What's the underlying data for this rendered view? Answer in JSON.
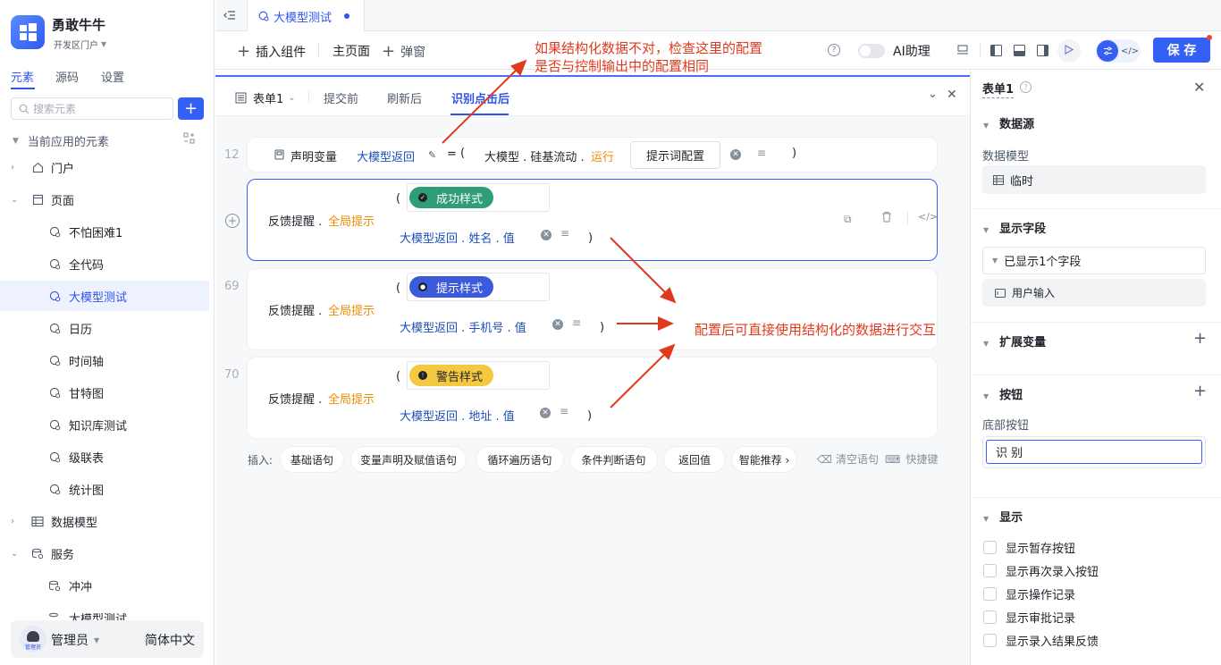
{
  "app": {
    "name": "勇敢牛牛",
    "portal": "开发区门户"
  },
  "sidebar": {
    "tabs": [
      "元素",
      "源码",
      "设置"
    ],
    "search_placeholder": "搜索元素",
    "section_title": "当前应用的元素",
    "items": [
      {
        "label": "门户",
        "icon": "home-icon"
      },
      {
        "label": "页面",
        "icon": "page-icon"
      },
      {
        "label": "不怕困难1",
        "icon": "page-item-icon"
      },
      {
        "label": "全代码",
        "icon": "page-item-icon"
      },
      {
        "label": "大模型测试",
        "icon": "page-item-icon"
      },
      {
        "label": "日历",
        "icon": "page-item-icon"
      },
      {
        "label": "时间轴",
        "icon": "page-item-icon"
      },
      {
        "label": "甘特图",
        "icon": "page-item-icon"
      },
      {
        "label": "知识库测试",
        "icon": "page-item-icon"
      },
      {
        "label": "级联表",
        "icon": "page-item-icon"
      },
      {
        "label": "统计图",
        "icon": "page-item-icon"
      },
      {
        "label": "数据模型",
        "icon": "table-icon"
      },
      {
        "label": "服务",
        "icon": "service-icon"
      },
      {
        "label": "冲冲",
        "icon": "service-item-icon"
      },
      {
        "label": "大模型测试",
        "icon": "service-item-icon"
      }
    ],
    "footer": {
      "user": "管理员",
      "avatar_text": "管理员",
      "language": "简体中文"
    }
  },
  "tabbar": {
    "tab_label": "大模型测试"
  },
  "toolbar": {
    "insert_component": "插入组件",
    "main_page": "主页面",
    "popup": "弹窗",
    "ai_assistant": "AI助理",
    "save": "保 存"
  },
  "editor": {
    "tabs": [
      "表单1",
      "提交前",
      "刷新后",
      "识别点击后"
    ],
    "line_numbers": [
      "12",
      "69",
      "70"
    ],
    "declare": {
      "keyword": "声明变量",
      "var_name": "大模型返回",
      "eq": "=",
      "open": "(",
      "source": "大模型 . 硅基流动 .",
      "run": "运行",
      "prompt_btn": "提示词配置",
      "close": ")"
    },
    "feedback_rows": [
      {
        "prefix": "反馈提醒 .",
        "mode": "全局提示",
        "style": "成功样式",
        "field": "大模型返回 . 姓名 . 值",
        "color": "#2e9d78"
      },
      {
        "prefix": "反馈提醒 .",
        "mode": "全局提示",
        "style": "提示样式",
        "field": "大模型返回 . 手机号 . 值",
        "color": "#3b5bdb"
      },
      {
        "prefix": "反馈提醒 .",
        "mode": "全局提示",
        "style": "警告样式",
        "field": "大模型返回 . 地址 . 值",
        "color": "#f5c842"
      }
    ],
    "open_paren": "(",
    "close_paren": ")",
    "insert_label": "插入:",
    "insert_chips": [
      "基础语句",
      "变量声明及赋值语句",
      "循环遍历语句",
      "条件判断语句",
      "返回值",
      "智能推荐 ›"
    ],
    "clear": "清空语句",
    "shortcut": "快捷键"
  },
  "annotations": {
    "top_line1": "如果结构化数据不对，检查这里的配置",
    "top_line2": "是否与控制输出中的配置相同",
    "right": "配置后可直接使用结构化的数据进行交互"
  },
  "right_panel": {
    "title": "表单1",
    "datasource": {
      "title": "数据源",
      "model_label": "数据模型",
      "model_value": "临时"
    },
    "fields": {
      "title": "显示字段",
      "summary": "已显示1个字段",
      "item": "用户输入"
    },
    "ext_vars": {
      "title": "扩展变量"
    },
    "buttons": {
      "title": "按钮",
      "bottom_label": "底部按钮",
      "bottom_value": "识 别"
    },
    "display": {
      "title": "显示",
      "options": [
        "显示暂存按钮",
        "显示再次录入按钮",
        "显示操作记录",
        "显示审批记录",
        "显示录入结果反馈"
      ]
    }
  }
}
